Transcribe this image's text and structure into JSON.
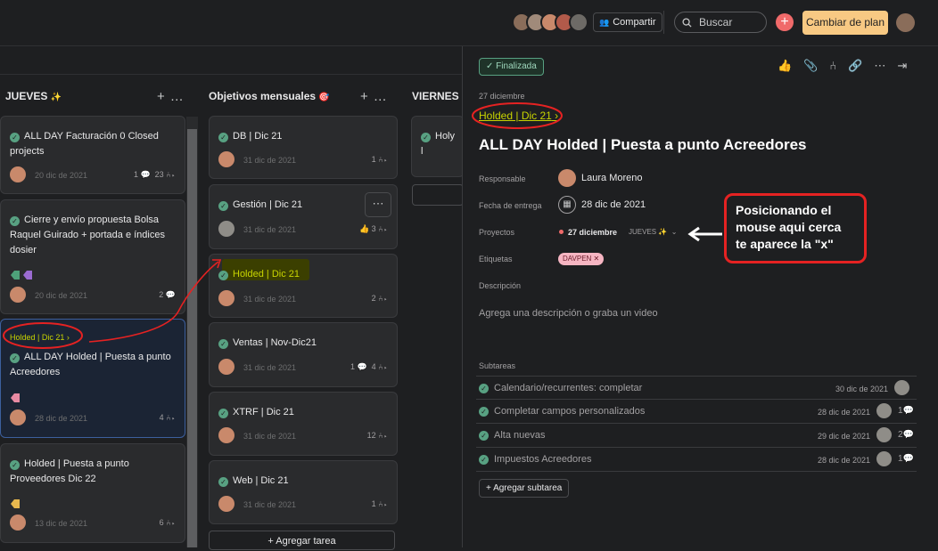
{
  "topbar": {
    "share_label": "Compartir",
    "search_placeholder": "Buscar",
    "upgrade_label": "Cambiar de plan"
  },
  "board": {
    "columns": [
      {
        "title": "JUEVES",
        "emoji": "✨"
      },
      {
        "title": "Objetivos mensuales",
        "emoji": "🎯"
      },
      {
        "title": "VIERNES",
        "emoji": "🎉"
      }
    ],
    "jueves_cards": [
      {
        "title": "ALL DAY Facturación 0 Closed projects",
        "date": "20 dic de 2021",
        "comments": "1",
        "subtasks": "23"
      },
      {
        "title": "Cierre y envío propuesta Bolsa Raquel Guirado + portada e índices dosier",
        "date": "20 dic de 2021",
        "comments": "2"
      },
      {
        "parent": "Holded | Dic 21",
        "title": "ALL DAY Holded | Puesta a punto Acreedores",
        "date": "28 dic de 2021",
        "subtasks": "4"
      },
      {
        "title": "Holded | Puesta a punto Proveedores Dic 22",
        "date": "13 dic de 2021",
        "subtasks": "6"
      }
    ],
    "objetivos_cards": [
      {
        "title": "DB | Dic 21",
        "date": "31 dic de 2021",
        "subtasks": "1"
      },
      {
        "title": "Gestión | Dic 21",
        "date": "31 dic de 2021",
        "subtasks": "3"
      },
      {
        "title": "Holded | Dic 21",
        "date": "31 dic de 2021",
        "subtasks": "2"
      },
      {
        "title": "Ventas | Nov-Dic21",
        "date": "31 dic de 2021",
        "comments": "1",
        "subtasks": "4"
      },
      {
        "title": "XTRF | Dic 21",
        "date": "31 dic de 2021",
        "subtasks": "12"
      },
      {
        "title": "Web | Dic 21",
        "date": "31 dic de 2021",
        "subtasks": "1"
      }
    ],
    "viernes_cards": [
      {
        "title": "Holy l"
      }
    ],
    "add_task_label": "+ Agregar tarea"
  },
  "detail": {
    "status_label": "Finalizada",
    "parent_date": "27 diciembre",
    "parent_link": "Holded | Dic 21",
    "title": "ALL DAY Holded | Puesta a punto Acreedores",
    "assignee_label": "Responsable",
    "assignee": "Laura Moreno",
    "due_label": "Fecha de entrega",
    "due": "28 dic de 2021",
    "projects_label": "Proyectos",
    "project_name": "27 diciembre",
    "project_section": "JUEVES",
    "project_section_emoji": "✨",
    "tags_label": "Etiquetas",
    "tag": "DAVPEN",
    "description_label": "Descripción",
    "description_placeholder": "Agrega una descripción o graba un video",
    "subtasks_label": "Subtareas",
    "subtasks": [
      {
        "name": "Calendario/recurrentes: completar",
        "date": "30 dic de 2021",
        "comments": ""
      },
      {
        "name": "Completar campos personalizados",
        "date": "28 dic de 2021",
        "comments": "1"
      },
      {
        "name": "Alta nuevas",
        "date": "29 dic de 2021",
        "comments": "2"
      },
      {
        "name": "Impuestos Acreedores",
        "date": "28 dic de 2021",
        "comments": "1"
      }
    ],
    "add_subtask_label": "+ Agregar subtarea"
  },
  "annotation": {
    "callout_text": "Posicionando el mouse aqui cerca te aparece la \"x\""
  },
  "colors": {
    "annotation_red": "#e52222",
    "highlight_yellow": "#c8d400",
    "accent_coral": "#f06a6a",
    "upgrade_bg": "#f8c983",
    "check_green": "#58a182"
  }
}
